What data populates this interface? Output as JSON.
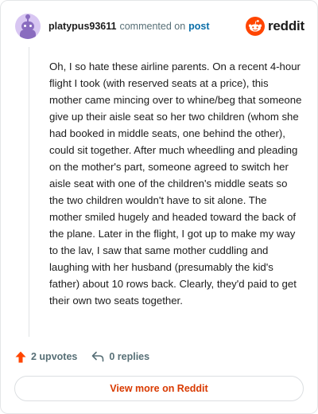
{
  "header": {
    "username": "platypus93611",
    "commented_text": "commented on",
    "post_link": "post",
    "brand_word": "reddit",
    "brand_color": "#ff4500"
  },
  "comment": {
    "text": "Oh, I so hate these airline parents. On a recent 4-hour flight I took (with reserved seats at a price), this mother came mincing over to whine/beg that someone give up their aisle seat so her two children (whom she had booked in middle seats, one behind the other), could sit together. After much wheedling and pleading on the mother's part, someone agreed to switch her aisle seat with one of the children's middle seats so the two children wouldn't have to sit alone. The mother smiled hugely and headed toward the back of the plane. Later in the flight, I got up to make my way to the lav, I saw that same mother cuddling and laughing with her husband (presumably the kid's father) about 10 rows back. Clearly, they'd paid to get their own two seats together."
  },
  "actions": {
    "upvotes_label": "2 upvotes",
    "replies_label": "0 replies",
    "upvote_icon": "upvote-arrow-icon",
    "reply_icon": "reply-arrow-icon",
    "upvote_color": "#ff4500"
  },
  "footer": {
    "view_more_label": "View more on Reddit",
    "accent": "#d93a00"
  }
}
